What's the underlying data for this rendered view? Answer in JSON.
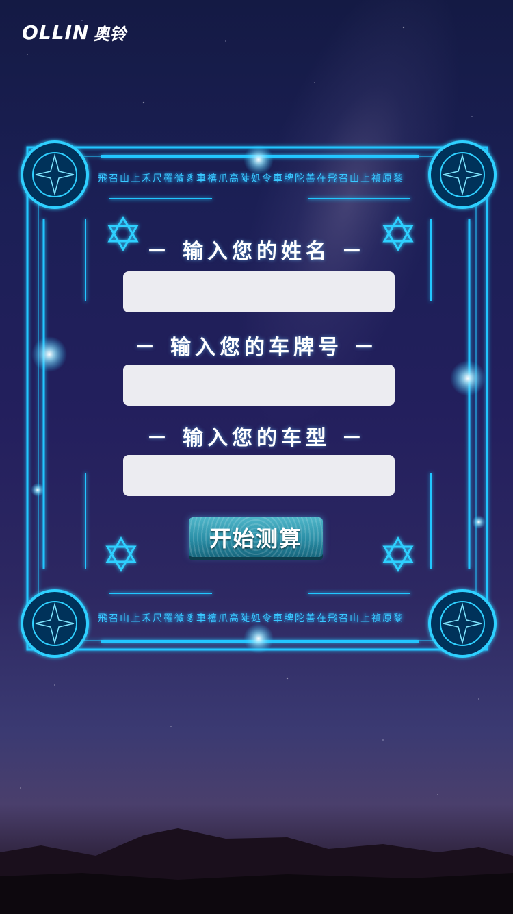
{
  "brand": {
    "logo_en": "OLLIN",
    "logo_cn": "奥铃"
  },
  "form": {
    "name_label": "－ 输入您的姓名 －",
    "plate_label": "－ 输入您的车牌号 －",
    "model_label": "－ 输入您的车型 －",
    "name_value": "",
    "plate_value": "",
    "model_value": "",
    "start_button": "开始测算"
  },
  "decor": {
    "rune_text": "飛召山上禾尺罹微豸車禧爪高陡処令車牌陀善在飛召山上禎原黎"
  },
  "colors": {
    "frame_glow": "#22c6ff",
    "input_bg": "#ececf1",
    "button": "#2a8ea6"
  }
}
